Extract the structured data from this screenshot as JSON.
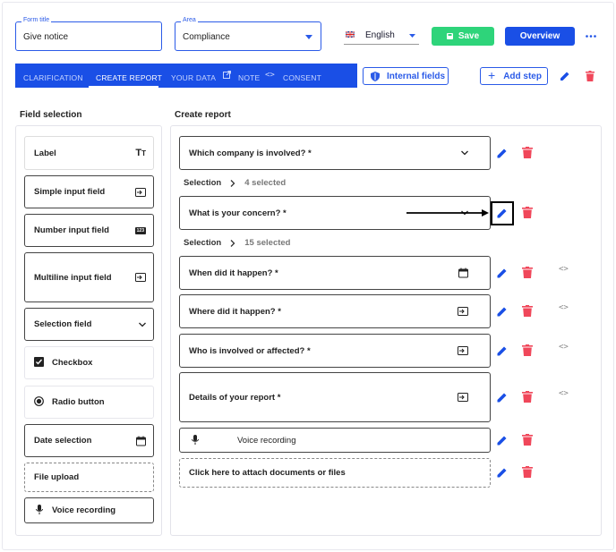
{
  "header": {
    "form_title": {
      "label": "Form title",
      "value": "Give notice"
    },
    "area": {
      "label": "Area",
      "value": "Compliance"
    },
    "language": "English",
    "save_label": "Save",
    "overview_label": "Overview"
  },
  "tabs": [
    {
      "label": "CLARIFICATION"
    },
    {
      "label": "CREATE REPORT"
    },
    {
      "label": "YOUR DATA"
    },
    {
      "label": "NOTE"
    },
    {
      "label": "CONSENT"
    }
  ],
  "toolbar": {
    "internal_fields": "Internal fields",
    "add_step": "Add step"
  },
  "field_selection": {
    "title": "Field selection",
    "items": [
      {
        "label": "Label"
      },
      {
        "label": "Simple input field"
      },
      {
        "label": "Number input field"
      },
      {
        "label": "Multiline input field"
      },
      {
        "label": "Selection field"
      },
      {
        "label": "Checkbox"
      },
      {
        "label": "Radio button"
      },
      {
        "label": "Date selection"
      },
      {
        "label": "File upload"
      },
      {
        "label": "Voice recording"
      }
    ]
  },
  "create_report": {
    "title": "Create report",
    "questions": [
      {
        "label": "Which company is involved? *"
      },
      {
        "label": "What is your concern? *"
      },
      {
        "label": "When did it happen? *"
      },
      {
        "label": "Where did it happen? *"
      },
      {
        "label": "Who is involved or affected? *"
      },
      {
        "label": "Details of your report *"
      },
      {
        "label": "Voice recording"
      },
      {
        "label": "Click here to attach documents or files"
      }
    ],
    "selections": [
      {
        "label": "Selection",
        "count": "4 selected"
      },
      {
        "label": "Selection",
        "count": "15 selected"
      }
    ],
    "code_icon": "<>"
  },
  "colors": {
    "primary": "#1a4fe6",
    "save_green": "#2ed47a",
    "delete_red": "#f0475a"
  }
}
